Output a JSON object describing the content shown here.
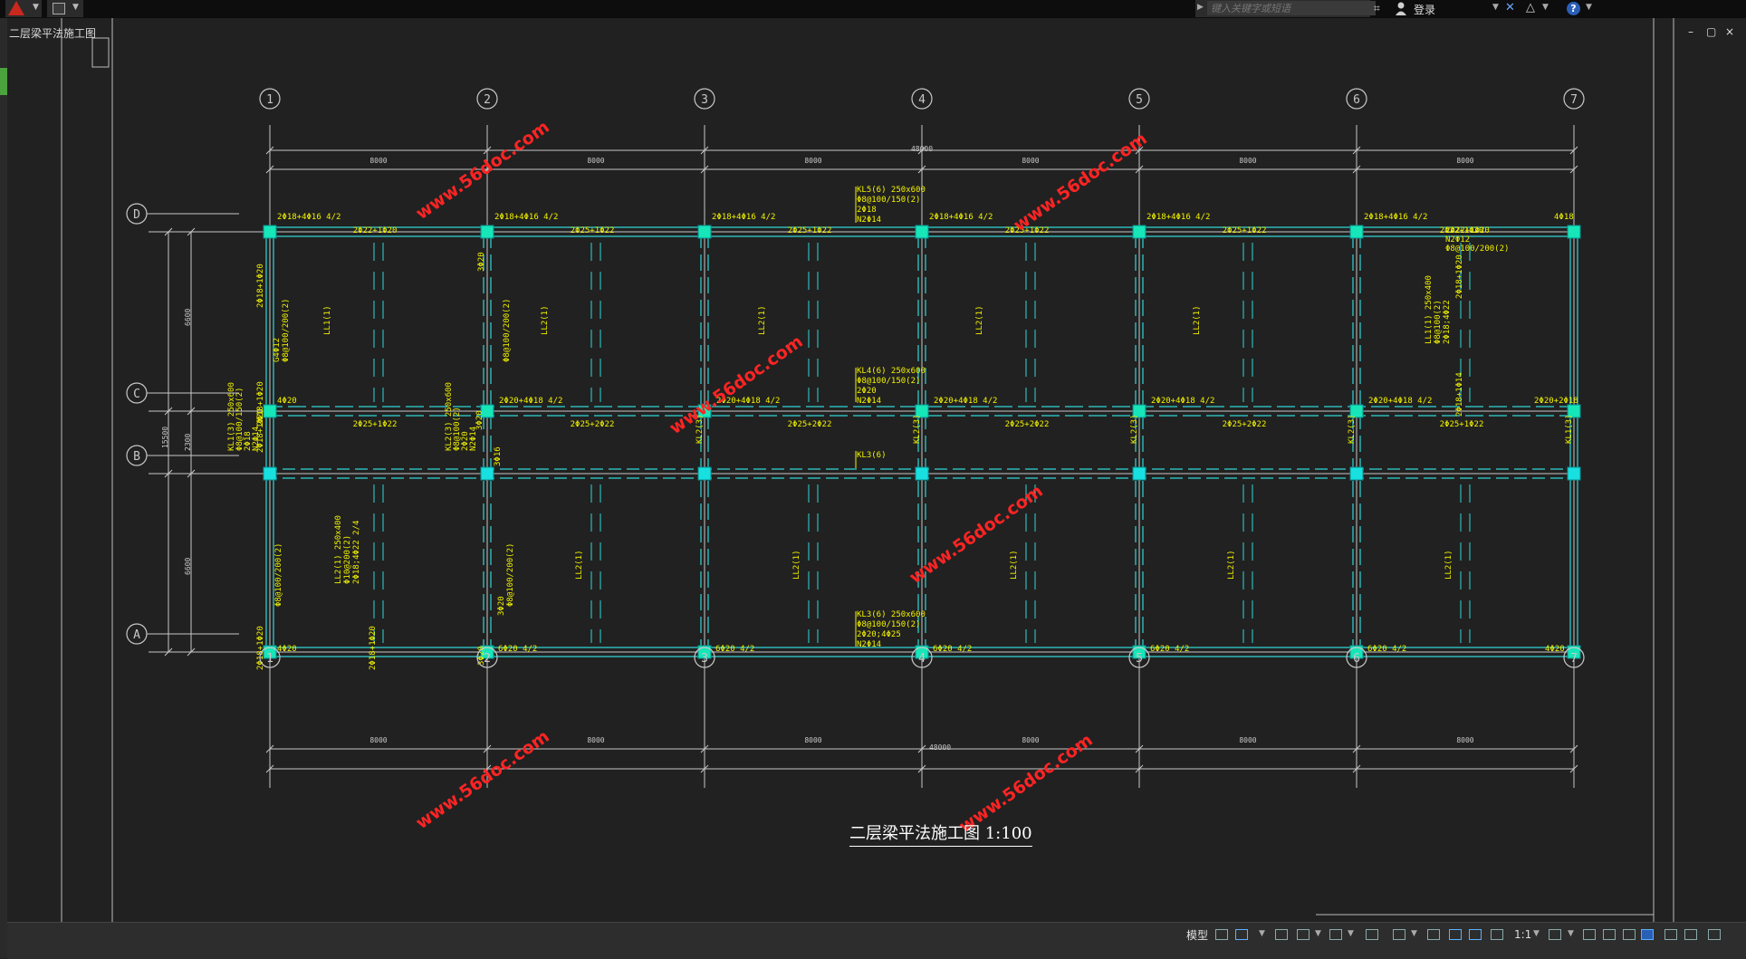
{
  "app": {
    "logo_icon": "autocad-logo-icon"
  },
  "top_bar": {
    "search_placeholder": "键入关键字或短语",
    "login_label": "登录",
    "window_controls": [
      "–",
      "▢",
      "×"
    ]
  },
  "left_panel": {
    "vertical_text": "二层梁平法施工图"
  },
  "status_bar": {
    "model_tab_label": "模型",
    "scale_label": "1:1"
  },
  "drawing": {
    "title": "二层梁平法施工图 1:100",
    "watermark": "www.56doc.com",
    "colors": {
      "grid": "#c8c8c8",
      "beam": "#30d6d6",
      "column": "#19e0e0",
      "annotation": "#f2f200",
      "watermark": "#ff2424",
      "background": "#212121"
    },
    "col_axes": [
      "1",
      "2",
      "3",
      "4",
      "5",
      "6",
      "7"
    ],
    "row_axes": [
      "D",
      "C",
      "B",
      "A"
    ],
    "total_dim": "48000",
    "bay_dims": [
      "8000",
      "8000",
      "8000",
      "8000",
      "8000",
      "8000"
    ],
    "row_dims": [
      "6600",
      "2300",
      "6600"
    ],
    "left_total_dim": "15500",
    "top_beam_labels": [
      "2Φ18+4Φ16 4/2",
      "2Φ18+4Φ16 4/2",
      "2Φ18+4Φ16 4/2",
      "2Φ18+4Φ16 4/2",
      "2Φ18+4Φ16 4/2",
      "2Φ18+4Φ16 4/2"
    ],
    "top_beam_end_label": "4Φ18",
    "top_sub_labels": [
      "2Φ22+1Φ20",
      "2Φ25+1Φ22",
      "2Φ25+1Φ22",
      "2Φ25+1Φ22",
      "2Φ25+1Φ22",
      "2Φ22+1Φ20"
    ],
    "mid_beam_labels": [
      "4Φ20",
      "2Φ20+4Φ18 4/2",
      "2Φ20+4Φ18 4/2",
      "2Φ20+4Φ18 4/2",
      "2Φ20+4Φ18 4/2",
      "2Φ20+4Φ18 4/2",
      "2Φ20+2Φ18"
    ],
    "mid_sub_labels": [
      "2Φ25+1Φ22",
      "2Φ25+2Φ22",
      "2Φ25+2Φ22",
      "2Φ25+2Φ22",
      "2Φ25+2Φ22",
      "2Φ25+1Φ22"
    ],
    "bottom_beam_labels": [
      "4Φ20",
      "6Φ20 4/2",
      "6Φ20 4/2",
      "6Φ20 4/2",
      "6Φ20 4/2",
      "6Φ20 4/2",
      "4Φ20"
    ],
    "kl5_label": [
      "KL5(6) 250x600",
      "Φ8@100/150(2)",
      "2Φ18",
      "N2Φ14"
    ],
    "kl4_label": [
      "KL4(6) 250x600",
      "Φ8@100/150(2)",
      "2Φ20",
      "N2Φ14"
    ],
    "kl3_label": "KL3(6)",
    "kl3b_label": [
      "KL3(6) 250x600",
      "Φ8@100/150(2)",
      "2Φ20;4Φ25",
      "N2Φ14"
    ],
    "kl1_left_label": [
      "KL1(3) 250x600",
      "Φ8@100/150(2)",
      "2Φ18",
      "N2Φ14"
    ],
    "kl2_label": [
      "KL2(3) 250x600",
      "Φ8@100(2)",
      "2Φ20",
      "N2Φ14"
    ],
    "kl2_small": "KL2(3)",
    "kl1_small": "KL1(3)",
    "ll1_label": "LL1(1)",
    "ll2_label": "LL2(1)",
    "ll1_right_label": [
      "LL1(1) 250x400",
      "Φ8@100(2)",
      "2Φ18;4Φ22"
    ],
    "ll2_lower_label": [
      "LL2(1) 250x400",
      "Φ10@200(2)",
      "2Φ18;4Φ22 2/4"
    ],
    "right_top_label": [
      "2Φ22+1Φ20",
      "N2Φ12",
      "Φ8@100/200(2)"
    ],
    "vertical_labels": {
      "a": "2Φ18+1Φ20",
      "b": "Φ8@100/200(2)",
      "c": "G4Φ12",
      "d": "3Φ20",
      "e": "Φ8@100/200(2)",
      "f": "2Φ18+1Φ20",
      "g": "2Φ18+1Φ20",
      "h": "3Φ20",
      "i": "3Φ16",
      "j": "2Φ18+1Φ14",
      "k": "2Φ18+1Φ20",
      "l": "Φ8@100/200(2)",
      "m": "3Φ20",
      "n": "Φ8@100/200(2)",
      "o": "2Φ18+1Φ20",
      "p": "2Φ18+1Φ20",
      "q": "3Φ20"
    }
  }
}
